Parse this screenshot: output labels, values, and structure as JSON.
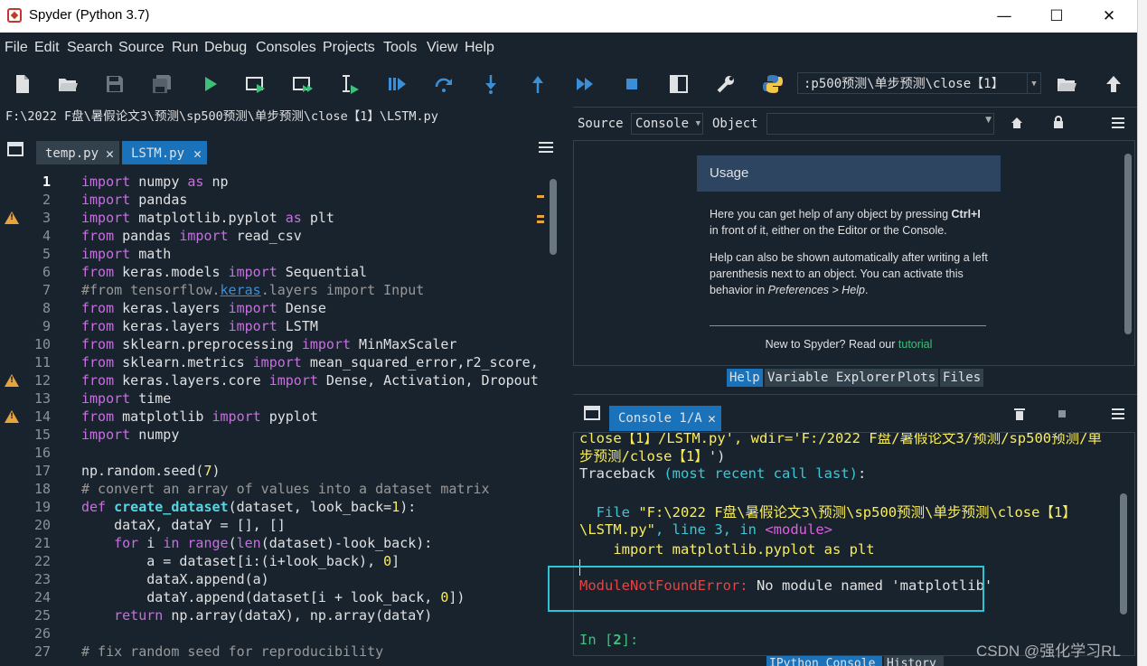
{
  "window": {
    "title": "Spyder (Python 3.7)",
    "minimize": "—",
    "maximize": "☐",
    "close": "✕"
  },
  "menu": [
    "File",
    "Edit",
    "Search",
    "Source",
    "Run",
    "Debug",
    "Consoles",
    "Projects",
    "Tools",
    "View",
    "Help"
  ],
  "toolbar": {
    "icons": [
      "new-file-icon",
      "open-file-icon",
      "save-icon",
      "save-all-icon",
      "run-icon",
      "run-cell-icon",
      "run-cell-advance-icon",
      "run-selection-icon",
      "debug-icon",
      "step-icon",
      "step-into-icon",
      "step-return-icon",
      "continue-icon",
      "stop-debug-icon",
      "maximize-pane-icon",
      "preferences-icon",
      "python-path-icon"
    ],
    "working_dir": ":p500预测\\单步预测\\close【1】"
  },
  "editor": {
    "file_path": "F:\\2022 F盘\\暑假论文3\\预测\\sp500预测\\单步预测\\close【1】\\LSTM.py",
    "tabs": [
      {
        "label": "temp.py",
        "close": "✕"
      },
      {
        "label": "LSTM.py",
        "close": "✕"
      }
    ],
    "line_numbers": [
      "1",
      "2",
      "3",
      "4",
      "5",
      "6",
      "7",
      "8",
      "9",
      "10",
      "11",
      "12",
      "13",
      "14",
      "15",
      "16",
      "17",
      "18",
      "19",
      "20",
      "21",
      "22",
      "23",
      "24",
      "25",
      "26",
      "27"
    ],
    "warning_lines": [
      3,
      12,
      14
    ]
  },
  "help": {
    "source_label": "Source",
    "source_value": "Console",
    "object_label": "Object",
    "usage_title": "Usage",
    "usage_p1a": "Here you can get help of any object by pressing ",
    "usage_p1b": "Ctrl+I",
    "usage_p1c": " in front of it, either on the Editor or the Console.",
    "usage_p2a": "Help can also be shown automatically after writing a left parenthesis next to an object. You can activate this behavior in ",
    "usage_p2b": "Preferences > Help",
    "usage_p2c": ".",
    "new_to": "New to Spyder? Read our ",
    "tutorial": "tutorial",
    "tabs": [
      "Help",
      "Variable Explorer",
      "Plots",
      "Files"
    ]
  },
  "console": {
    "tab_label": "Console 1/A",
    "tab_close": "✕",
    "line_top_a": "close【1】/LSTM.py', wdir='F:/2022 F盘/暑假论文3/预测/sp500预测/单",
    "line_top_b": "步预测/close【1】",
    "line_top_c": "')",
    "traceback_a": "Traceback ",
    "traceback_b": "(most recent call last)",
    "traceback_c": ":",
    "file_a": "  File ",
    "file_b": "\"F:\\2022 F盘\\暑假论文3\\预测\\sp500预测\\单步预测\\close【1】",
    "file_c": "\\LSTM.py\"",
    "file_d": ", line 3, in ",
    "file_e": "<module>",
    "import_line": "    import matplotlib.pyplot as plt",
    "error_name": "ModuleNotFoundError:",
    "error_msg": " No module named 'matplotlib'",
    "prompt_a": "In [",
    "prompt_b": "2",
    "prompt_c": "]:",
    "bottom_tabs": [
      "IPython Console",
      "History"
    ]
  },
  "watermark": "CSDN @强化学习RL",
  "colors": {
    "background": "#19232d",
    "accent": "#1a72bb",
    "error": "#e34545",
    "prompt": "#3ec07a",
    "warning": "#e8a33d",
    "highlight_box": "#2ec4d4"
  }
}
